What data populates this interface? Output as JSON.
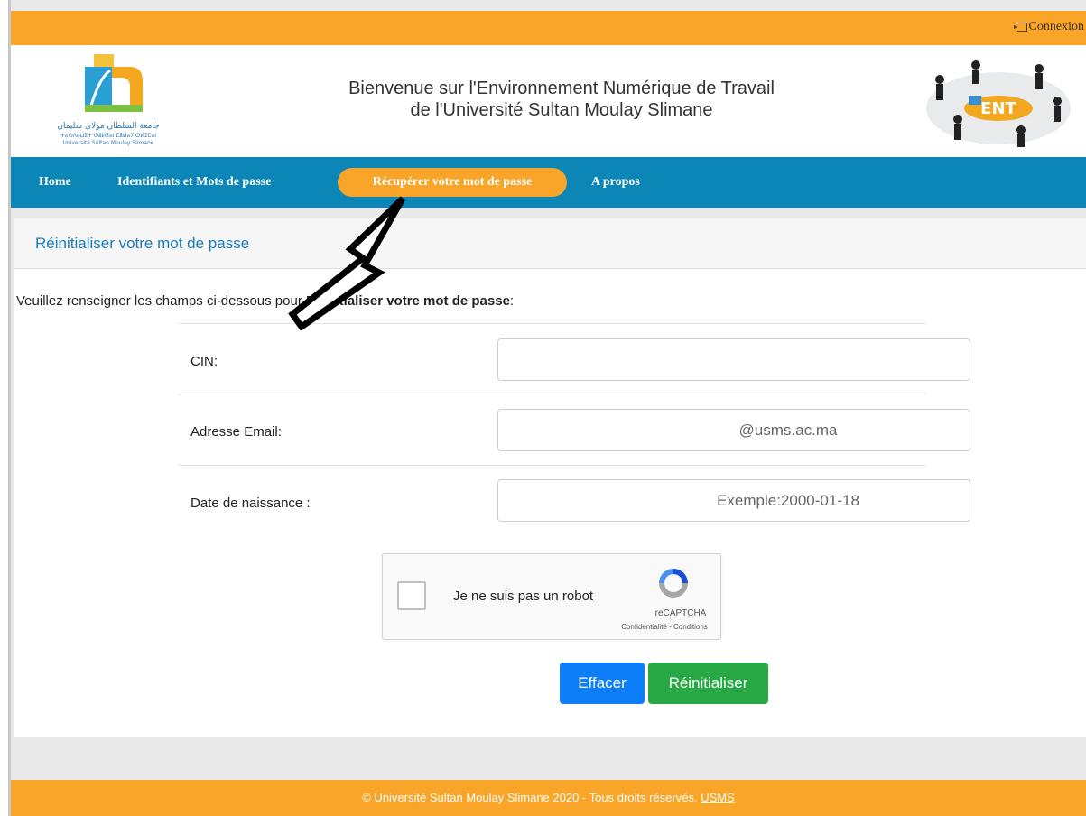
{
  "topbar": {
    "connexion_label": "Connexion"
  },
  "header": {
    "welcome_line1": "Bienvenue sur l'Environnement Numérique de Travail",
    "welcome_line2": "de l'Université Sultan Moulay Slimane",
    "logo_text_line1": "جامعة السلطان مولاي سليمان",
    "logo_text_line2": "ⵜⴰⵙⴷⴰⵡⵉⵜ ⵙⵓⵍⵟⴰⵏ ⵎⵓⵍⴰⵢ ⵙⵍⵉⵎⴰⵏ",
    "logo_text_line3": "Université Sultan Moulay Slimane",
    "ent_badge": "ENT"
  },
  "nav": {
    "items": [
      {
        "label": "Home"
      },
      {
        "label": "Identifiants et Mots de passe"
      },
      {
        "label": "Récupérer votre mot de passe"
      },
      {
        "label": "A propos"
      }
    ]
  },
  "panel": {
    "title": "Réinitialiser votre mot de passe",
    "intro_prefix": "Veuillez renseigner les champs ci-dessous pour ",
    "intro_bold": "Réinitialiser votre mot de passe",
    "intro_suffix": ":"
  },
  "form": {
    "cin_label": "CIN:",
    "cin_value": "",
    "email_label": "Adresse Email:",
    "email_placeholder": "@usms.ac.ma",
    "dob_label": "Date de naissance :",
    "dob_placeholder": "Exemple:2000-01-18"
  },
  "captcha": {
    "label": "Je ne suis pas un robot",
    "brand": "reCAPTCHA",
    "links": "Confidentialité - Conditions"
  },
  "buttons": {
    "clear": "Effacer",
    "reset": "Réinitialiser"
  },
  "footer": {
    "text": "© Université Sultan Moulay Slimane 2020 - Tous droits réservés. ",
    "link": "USMS"
  },
  "colors": {
    "accent_orange": "#f9a529",
    "nav_blue": "#0b86b6",
    "title_blue": "#1a7bbd",
    "btn_blue": "#0d7ef8",
    "btn_green": "#28a745"
  }
}
